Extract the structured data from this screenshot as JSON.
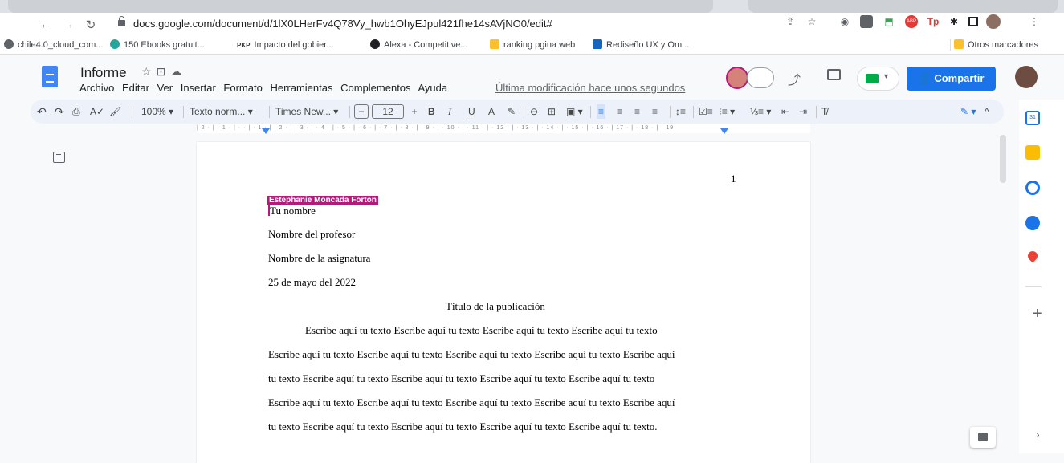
{
  "browser": {
    "url": "docs.google.com/document/d/1lX0LHerFv4Q78Vy_hwb1OhyEJpul421fhe14sAVjNO0/edit#",
    "bookmarks": [
      "chile4.0_cloud_com...",
      "150 Ebooks gratuit...",
      "Impacto del gobier...",
      "Alexa - Competitive...",
      "ranking pgina web",
      "Rediseño UX y Om..."
    ],
    "bookmark_prefix_pkp": "PKP",
    "other_bookmarks": "Otros marcadores"
  },
  "docs": {
    "title": "Informe",
    "menus": [
      "Archivo",
      "Editar",
      "Ver",
      "Insertar",
      "Formato",
      "Herramientas",
      "Complementos",
      "Ayuda"
    ],
    "last_modified": "Última modificación hace unos segundos",
    "share_label": "Compartir"
  },
  "toolbar": {
    "zoom": "100%",
    "style": "Texto norm...",
    "font": "Times New...",
    "font_size": "12",
    "minus": "−",
    "plus": "+",
    "bold": "B",
    "italic": "I",
    "underline": "U",
    "text_color": "A"
  },
  "ruler": {
    "text": "| 2 · | · 1 · | ·  · | · 1 · | · 2 · | · 3 · | · 4 · | · 5 · | · 6 · | · 7 · | · 8 · | · 9 · | · 10 · | · 11 · | · 12 · | · 13 · | · 14 · | · 15 · | · 16 · | 17 · | · 18 · | · 19"
  },
  "document": {
    "page_number": "1",
    "collaborator": "Estephanie Moncada Forton",
    "lines": [
      "Tu nombre",
      "Nombre del profesor",
      "Nombre de la asignatura",
      "25 de mayo del 2022",
      "Título de la publicación",
      "Escribe aquí tu texto Escribe aquí tu texto Escribe aquí tu texto Escribe aquí tu texto",
      "Escribe aquí tu texto Escribe aquí tu texto Escribe aquí tu texto Escribe aquí tu texto Escribe aquí",
      "tu texto Escribe aquí tu texto Escribe aquí tu texto Escribe aquí tu texto Escribe aquí tu texto",
      "Escribe aquí tu texto Escribe aquí tu texto Escribe aquí tu texto Escribe aquí tu texto Escribe aquí",
      "tu texto Escribe aquí tu texto Escribe aquí tu texto Escribe aquí tu texto Escribe aquí tu texto."
    ]
  },
  "colors": {
    "accent": "#1a73e8",
    "collaborator": "#b31b7a",
    "docs_blue": "#4285f4"
  },
  "icons": [
    "back-icon",
    "forward-icon",
    "reload-icon",
    "lock-icon",
    "share-page-icon",
    "star-icon",
    "camera-icon",
    "extension-icon",
    "abp-icon",
    "tp-icon",
    "puzzle-icon",
    "sidebar-icon",
    "menu-icon",
    "docs-logo-icon",
    "star-icon",
    "move-icon",
    "cloud-status-icon",
    "trend-icon",
    "comments-icon",
    "meet-icon",
    "undo-icon",
    "redo-icon",
    "print-icon",
    "spellcheck-icon",
    "paint-format-icon",
    "highlight-icon",
    "link-icon",
    "comment-icon",
    "image-icon",
    "align-left-icon",
    "align-center-icon",
    "align-right-icon",
    "justify-icon",
    "line-spacing-icon",
    "checklist-icon",
    "bullets-icon",
    "numbered-icon",
    "indent-decrease-icon",
    "indent-increase-icon",
    "clear-format-icon",
    "pencil-mode-icon",
    "collapse-icon",
    "outline-icon",
    "calendar-icon",
    "keep-icon",
    "tasks-icon",
    "contacts-icon",
    "maps-icon",
    "add-icon",
    "expand-icon",
    "add-comment-icon"
  ]
}
